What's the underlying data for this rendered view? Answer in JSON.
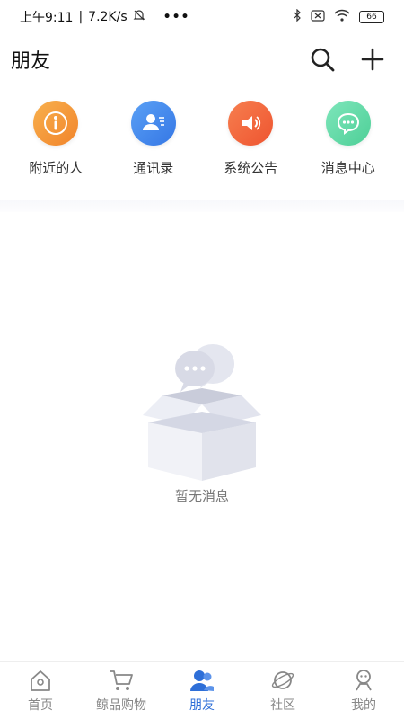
{
  "status_bar": {
    "time": "上午9:11",
    "speed": "7.2K/s",
    "battery": "66",
    "icons": [
      "mute-bell-icon",
      "more-dots-icon",
      "bluetooth-icon",
      "no-sim-icon",
      "wifi-icon",
      "battery-icon"
    ]
  },
  "header": {
    "title": "朋友",
    "icons": [
      "search-icon",
      "plus-icon"
    ]
  },
  "quick_entries": [
    {
      "label": "附近的人",
      "icon": "info-icon",
      "color": "#f59a3c"
    },
    {
      "label": "通讯录",
      "icon": "contact-icon",
      "color": "#4a8df0"
    },
    {
      "label": "系统公告",
      "icon": "speaker-icon",
      "color": "#f5693f"
    },
    {
      "label": "消息中心",
      "icon": "chat-icon",
      "color": "#5fd9a6"
    }
  ],
  "empty_state": {
    "text": "暂无消息",
    "icon": "empty-box-icon"
  },
  "bottom_nav": [
    {
      "label": "首页",
      "icon": "home-icon",
      "active": false
    },
    {
      "label": "鲸品购物",
      "icon": "cart-icon",
      "active": false
    },
    {
      "label": "朋友",
      "icon": "friends-icon",
      "active": true
    },
    {
      "label": "社区",
      "icon": "planet-icon",
      "active": false
    },
    {
      "label": "我的",
      "icon": "profile-icon",
      "active": false
    }
  ],
  "colors": {
    "accent": "#2e6fd8",
    "inactive": "#888888"
  }
}
